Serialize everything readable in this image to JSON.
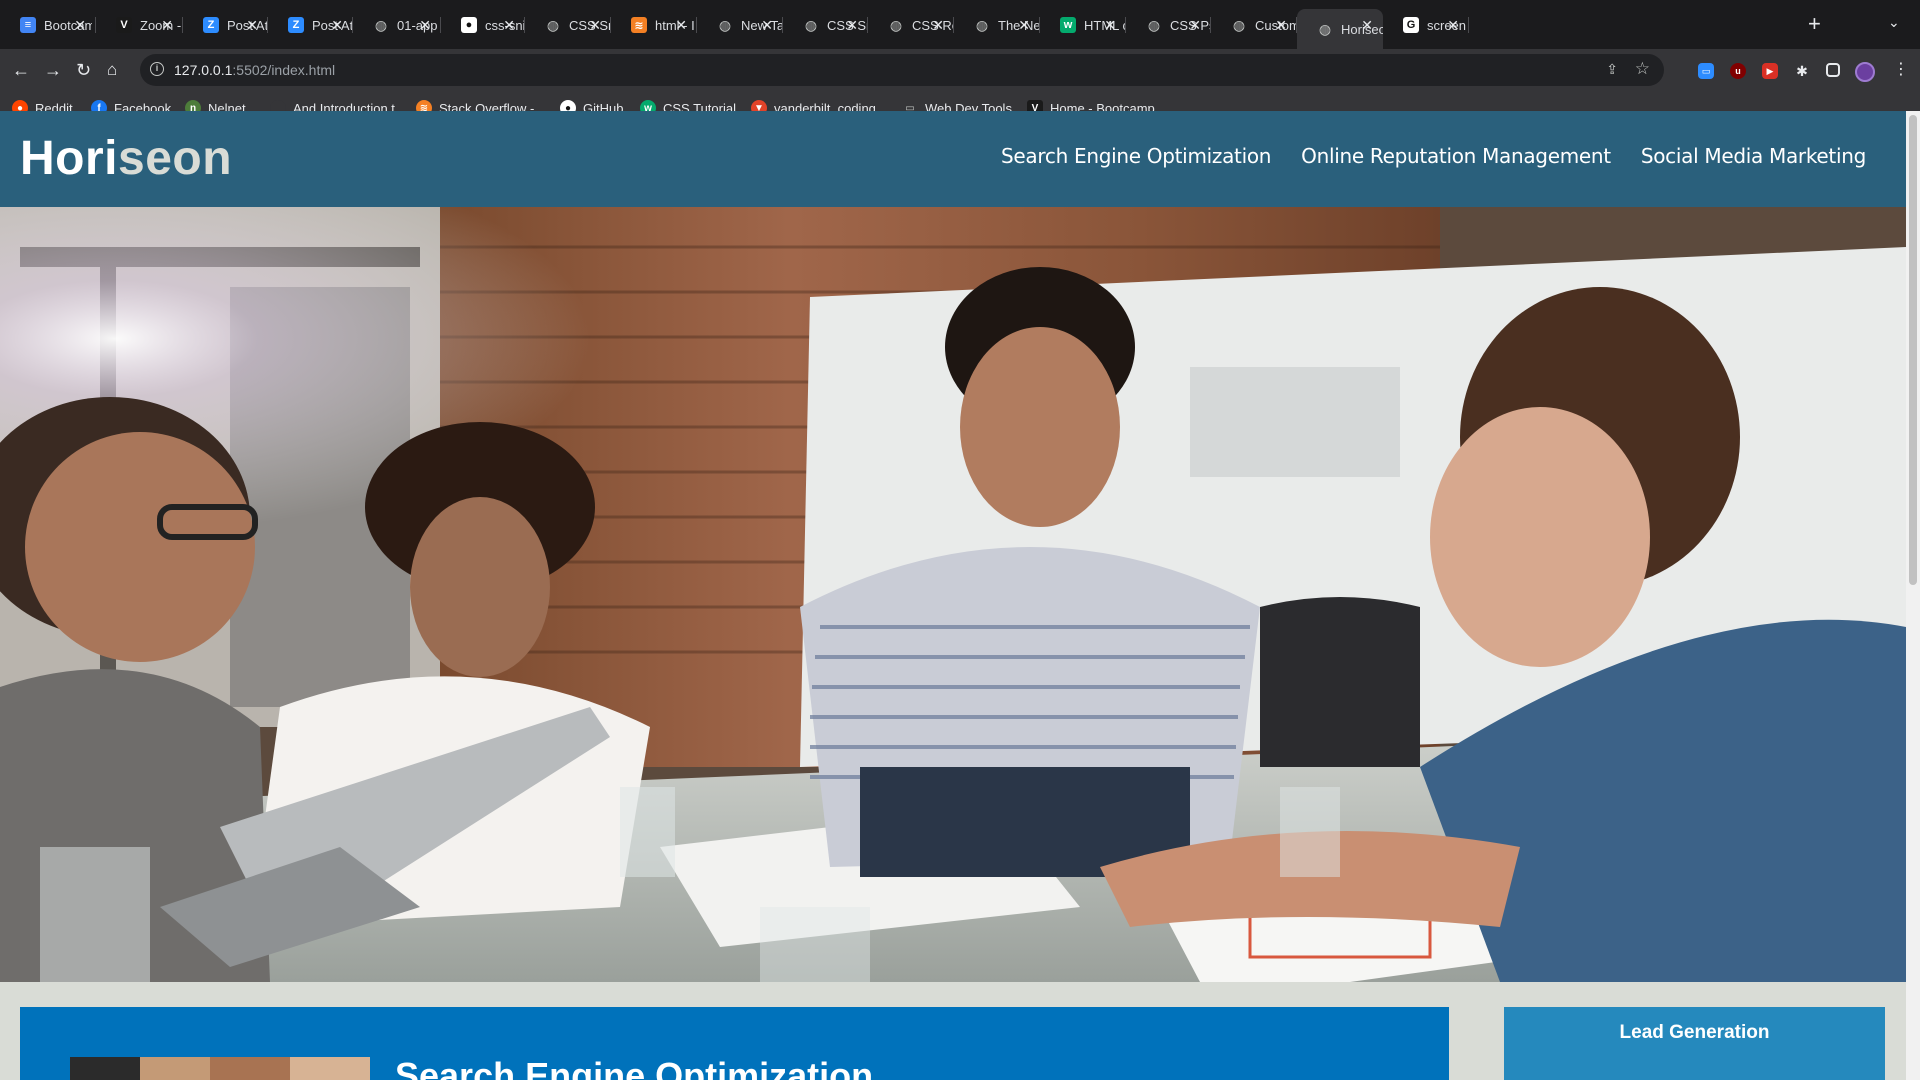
{
  "browser": {
    "tabs": [
      {
        "label": "Bootcamp",
        "icon": "doc-icon",
        "color": "#4285f4"
      },
      {
        "label": "Zoom - V",
        "icon": "v-icon",
        "color": "#1a1a1a"
      },
      {
        "label": "Post At",
        "icon": "z-icon",
        "color": "#2d8cff"
      },
      {
        "label": "Post At",
        "icon": "z-icon",
        "color": "#2d8cff"
      },
      {
        "label": "01-app",
        "icon": "globe-icon",
        "color": "#5f6368"
      },
      {
        "label": "css-snippets",
        "icon": "github-icon",
        "color": "#ffffff"
      },
      {
        "label": "CSS Sn",
        "icon": "globe-icon",
        "color": "#5f6368"
      },
      {
        "label": "html - I",
        "icon": "stackoverflow-icon",
        "color": "#f48024"
      },
      {
        "label": "New Tab",
        "icon": "globe-icon",
        "color": "#5f6368"
      },
      {
        "label": "CSS Sn",
        "icon": "globe-icon",
        "color": "#5f6368"
      },
      {
        "label": "CSS Re",
        "icon": "globe-icon",
        "color": "#5f6368"
      },
      {
        "label": "The Ne",
        "icon": "globe-icon",
        "color": "#5f6368"
      },
      {
        "label": "HTML c",
        "icon": "w3-icon",
        "color": "#04aa6d"
      },
      {
        "label": "CSS Ps",
        "icon": "globe-icon",
        "color": "#5f6368"
      },
      {
        "label": "Custom",
        "icon": "globe-icon",
        "color": "#5f6368"
      },
      {
        "label": "Horiseon",
        "icon": "globe-icon",
        "color": "#5f6368",
        "active": true
      },
      {
        "label": "screen",
        "icon": "google-icon",
        "color": "#ffffff"
      }
    ],
    "url_host": "127.0.0.1",
    "url_path": ":5502/index.html",
    "bookmarks": [
      {
        "label": "Reddit",
        "icon": "reddit-icon",
        "color": "#ff4500"
      },
      {
        "label": "Facebook",
        "icon": "facebook-icon",
        "color": "#1877f2"
      },
      {
        "label": "Nelnet",
        "icon": "nelnet-icon",
        "color": "#4d7c3a"
      },
      {
        "label": "And Introduction t...",
        "icon": "blank-icon",
        "color": "#353538"
      },
      {
        "label": "Stack Overflow -...",
        "icon": "stackoverflow-icon",
        "color": "#f48024"
      },
      {
        "label": "GitHub",
        "icon": "github-icon",
        "color": "#ffffff"
      },
      {
        "label": "CSS Tutorial",
        "icon": "w3-icon",
        "color": "#04aa6d"
      },
      {
        "label": "vanderbilt_coding...",
        "icon": "gitlab-icon",
        "color": "#e24329"
      },
      {
        "label": "Web Dev Tools",
        "icon": "folder-icon",
        "color": "#9aa0a6"
      },
      {
        "label": "Home - Bootcamp...",
        "icon": "v-icon",
        "color": "#1a1a1a"
      }
    ]
  },
  "site": {
    "logo_main": "Hori",
    "logo_accent": "seon",
    "nav": [
      "Search Engine Optimization",
      "Online Reputation Management",
      "Social Media Marketing"
    ],
    "hero_alt": "Four people working at a conference table",
    "section_title": "Search Engine Optimization",
    "benefit_title": "Lead Generation"
  },
  "colors": {
    "header_bg": "#2a607c",
    "content_bg": "#0072bb",
    "benefits_bg": "#2589bd",
    "page_bg": "#d9dcd6"
  }
}
